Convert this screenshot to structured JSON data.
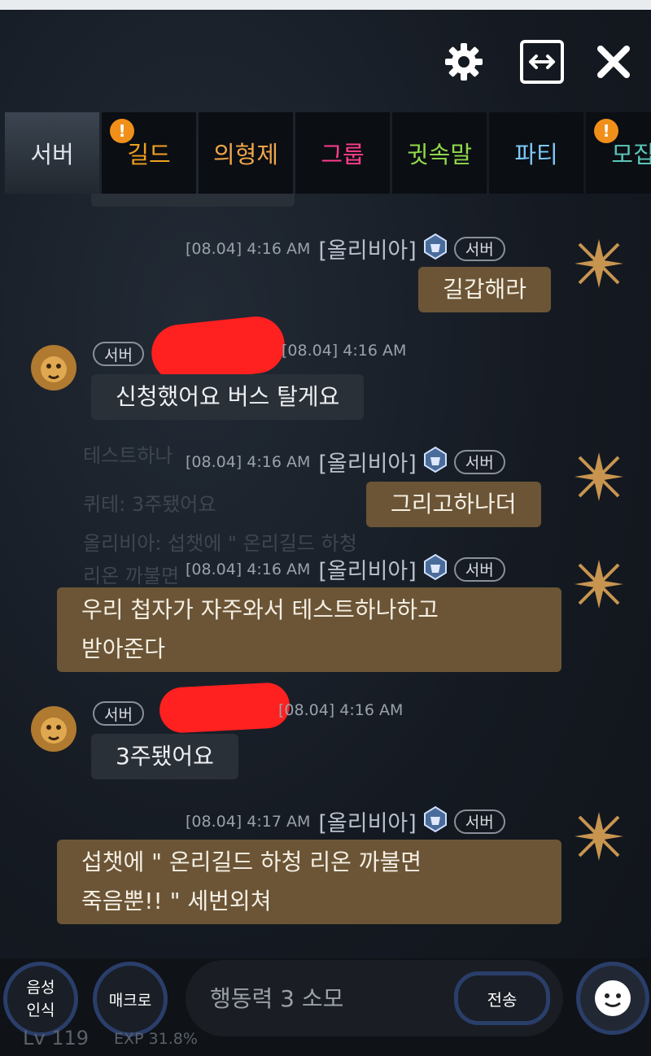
{
  "header": {
    "settings_icon": "gear-icon",
    "expand_icon": "expand-icon",
    "close_icon": "close-icon"
  },
  "tabs": [
    {
      "label": "서버",
      "color": "#d8dde4",
      "badge": ""
    },
    {
      "label": "길드",
      "color": "#f0a020",
      "badge": "!"
    },
    {
      "label": "의형제",
      "color": "#f0a64a",
      "badge": ""
    },
    {
      "label": "그룹",
      "color": "#ff3d8c",
      "badge": ""
    },
    {
      "label": "귓속말",
      "color": "#90d84a",
      "badge": ""
    },
    {
      "label": "파티",
      "color": "#7ec8f8",
      "badge": ""
    },
    {
      "label": "모집",
      "color": "#5cc6b8",
      "badge": "!"
    }
  ],
  "messages": [
    {
      "time": "[08.04] 4:16 AM",
      "name": "[올리비아]",
      "tag": "서버",
      "text": "길갑해라"
    },
    {
      "time": "[08.04] 4:16 AM",
      "tag": "서버",
      "text": "신청했어요 버스 탈게요"
    },
    {
      "time": "[08.04] 4:16 AM",
      "name": "[올리비아]",
      "tag": "서버",
      "text": "그리고하나더"
    },
    {
      "time": "[08.04] 4:16 AM",
      "name": "[올리비아]",
      "tag": "서버",
      "line1": "우리 첩자가 자주와서 테스트하나하고",
      "line2": "받아준다"
    },
    {
      "time": "[08.04] 4:16 AM",
      "tag": "서버",
      "text": "3주됐어요"
    },
    {
      "time": "[08.04] 4:17 AM",
      "name": "[올리비아]",
      "tag": "서버",
      "line1": "섭챗에 \" 온리길드 하청 리온 까불면",
      "line2": "죽음뿐!! \"  세번외쳐"
    }
  ],
  "background_text": {
    "line1": "테스트하나",
    "line2": "퀴테: 3주됐어요",
    "line3": "올리비아: 섭챗에 \" 온리길드 하청",
    "line4": "리온 까불면"
  },
  "bottom": {
    "voice_line1": "음성",
    "voice_line2": "인식",
    "macro": "매크로",
    "input_placeholder": "행동력 3 소모",
    "send": "전송",
    "level": "Lv 119",
    "exp": "EXP 31.8%",
    "emoji_icon": "emoji-icon"
  }
}
